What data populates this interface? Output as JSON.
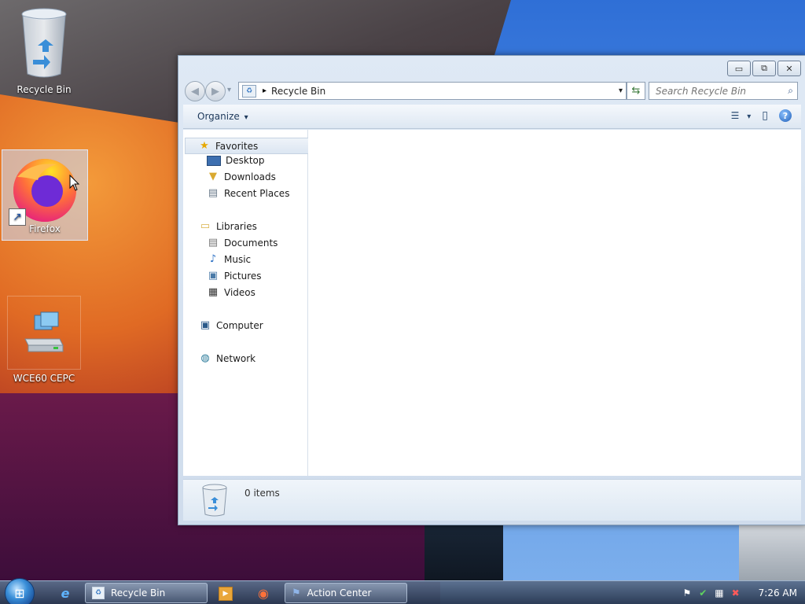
{
  "desktop": {
    "icons": [
      {
        "label": "Recycle Bin"
      },
      {
        "label": "Firefox"
      },
      {
        "label": "WCE60 CEPC"
      }
    ]
  },
  "window": {
    "title": "Recycle Bin",
    "controls": {
      "minimize": "▭",
      "maximize": "⧉",
      "close": "✕"
    },
    "nav": {
      "back": "◀",
      "forward": "▶",
      "history": "▾"
    },
    "address": {
      "separator": "▸",
      "path": "Recycle Bin",
      "dropdown": "▾"
    },
    "refresh": "⇆",
    "search": {
      "placeholder": "Search Recycle Bin",
      "icon": "⌕"
    },
    "toolbar": {
      "organize": "Organize",
      "organize_arrow": "▾",
      "views": "☰",
      "views_arrow": "▾",
      "preview": "▯",
      "help": "?"
    },
    "nav_pane": {
      "favorites": {
        "label": "Favorites",
        "items": [
          "Desktop",
          "Downloads",
          "Recent Places"
        ]
      },
      "libraries": {
        "label": "Libraries",
        "items": [
          "Documents",
          "Music",
          "Pictures",
          "Videos"
        ]
      },
      "computer": "Computer",
      "network": "Network"
    },
    "details": {
      "count": "0 items"
    }
  },
  "taskbar": {
    "start": "⊞",
    "pinned": {
      "ie": "e",
      "media": "▶",
      "firefox": "◉"
    },
    "tasks": [
      {
        "label": "Recycle Bin"
      },
      {
        "label": "Action Center"
      }
    ],
    "tray": {
      "flag": "⚑",
      "shield": "✔",
      "network": "▦",
      "volume": "✖"
    },
    "clock": "7:26 AM"
  }
}
